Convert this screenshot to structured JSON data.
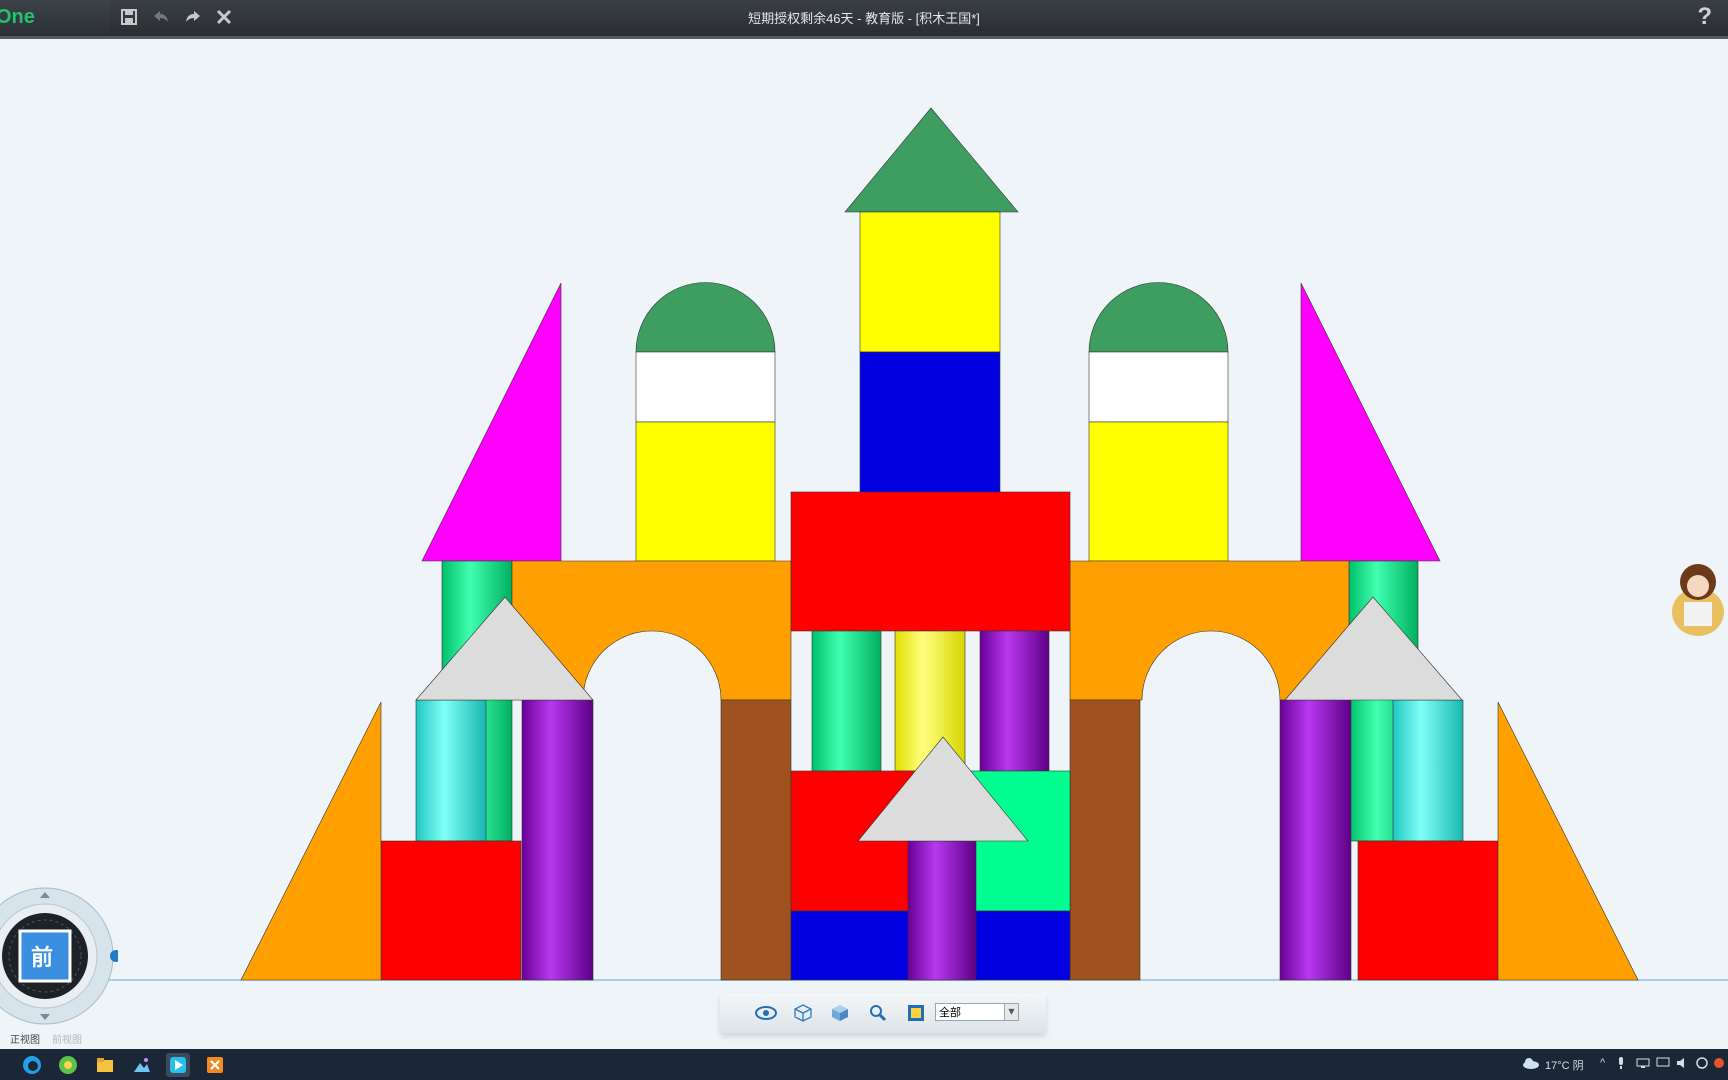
{
  "app": {
    "logo_text": "One",
    "window_title": "短期授权剩余46天 - 教育版 - [积木王国*]",
    "help_label": "?"
  },
  "titlebar_icons": [
    "save-icon",
    "undo-icon",
    "redo-icon",
    "close-icon"
  ],
  "toolbar": {
    "icons": [
      "eye-icon",
      "cube-outline-icon",
      "cube-solid-icon",
      "zoom-icon",
      "display-mode-icon"
    ],
    "filter_value": "全部"
  },
  "navigator": {
    "face_label": "前",
    "views": [
      "正视图",
      "前视图"
    ]
  },
  "taskbar": {
    "apps": [
      "edge-icon",
      "browser-icon",
      "file-explorer-icon",
      "photos-icon",
      "3done-icon",
      "app-icon"
    ],
    "weather": "17°C 阴"
  },
  "colors": {
    "red": "#ff0000",
    "yellow": "#ffff00",
    "blue": "#0000e0",
    "magenta": "#ff00ff",
    "green": "#3e9e62",
    "orange": "#ffa000",
    "brown": "#a0521e",
    "mint": "#00ff90",
    "cyan": "#45f5ec",
    "purple": "#9a00d6",
    "grey": "#dcdcdc",
    "white": "#ffffff",
    "accent": "#23c36e"
  }
}
